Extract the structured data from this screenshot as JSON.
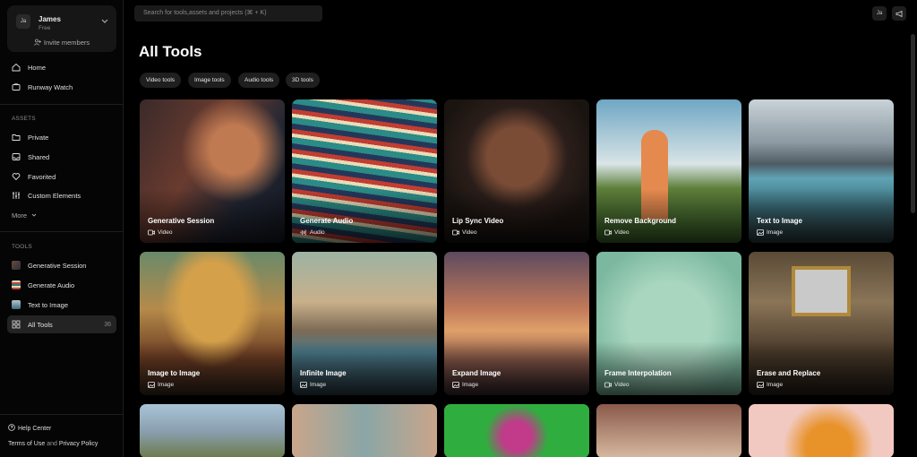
{
  "workspace": {
    "avatar": "Ja",
    "name": "James",
    "plan": "Free",
    "invite": "Invite members"
  },
  "nav": {
    "home": "Home",
    "runway_watch": "Runway Watch"
  },
  "assets": {
    "label": "ASSETS",
    "items": [
      {
        "label": "Private",
        "icon": "folder-icon"
      },
      {
        "label": "Shared",
        "icon": "inbox-icon"
      },
      {
        "label": "Favorited",
        "icon": "heart-icon"
      },
      {
        "label": "Custom Elements",
        "icon": "sliders-icon"
      }
    ],
    "more": "More"
  },
  "tools": {
    "label": "TOOLS",
    "items": [
      {
        "label": "Generative Session"
      },
      {
        "label": "Generate Audio"
      },
      {
        "label": "Text to Image"
      },
      {
        "label": "All Tools",
        "count": "36"
      }
    ]
  },
  "footer": {
    "help": "Help Center",
    "terms": "Terms of Use",
    "and": "and",
    "privacy": "Privacy Policy"
  },
  "search": {
    "placeholder": "Search for tools,assets and projects (⌘ + K)"
  },
  "topbar": {
    "avatar": "Ja"
  },
  "page": {
    "title": "All Tools"
  },
  "filters": [
    "Video tools",
    "Image tools",
    "Audio tools",
    "3D tools"
  ],
  "cards": [
    {
      "title": "Generative Session",
      "type": "Video"
    },
    {
      "title": "Generate Audio",
      "type": "Audio"
    },
    {
      "title": "Lip Sync Video",
      "type": "Video"
    },
    {
      "title": "Remove Background",
      "type": "Video"
    },
    {
      "title": "Text to Image",
      "type": "Image"
    },
    {
      "title": "Image to Image",
      "type": "Image"
    },
    {
      "title": "Infinite Image",
      "type": "Image"
    },
    {
      "title": "Expand Image",
      "type": "Image"
    },
    {
      "title": "Frame Interpolation",
      "type": "Video"
    },
    {
      "title": "Erase and Replace",
      "type": "Image"
    }
  ],
  "colors": {
    "background": "#000000",
    "sidebar": "#050505",
    "active": "#232323",
    "chip": "#1f1f1f"
  }
}
